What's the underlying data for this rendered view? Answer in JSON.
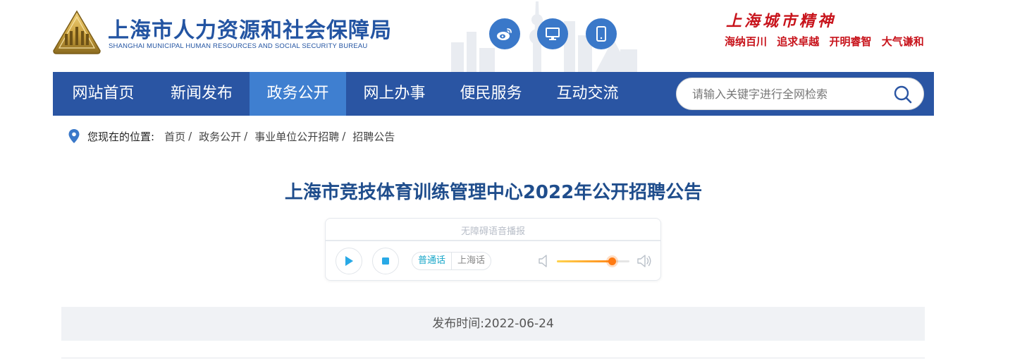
{
  "header": {
    "org_name": "上海市人力资源和社会保障局",
    "org_name_en": "SHANGHAI MUNICIPAL HUMAN RESOURCES AND SOCIAL SECURITY BUREAU",
    "share_icons": [
      "weibo-icon",
      "monitor-icon",
      "mobile-icon"
    ],
    "spirit_title": "上海城市精神",
    "spirit_phrases": [
      "海纳百川",
      "追求卓越",
      "开明睿智",
      "大气谦和"
    ]
  },
  "nav": {
    "items": [
      {
        "label": "网站首页"
      },
      {
        "label": "新闻发布"
      },
      {
        "label": "政务公开"
      },
      {
        "label": "网上办事"
      },
      {
        "label": "便民服务"
      },
      {
        "label": "互动交流"
      }
    ],
    "active": "政务公开",
    "search_placeholder": "请输入关键字进行全网检索"
  },
  "breadcrumb": {
    "lead": "您现在的位置:",
    "items": [
      "首页",
      "政务公开",
      "事业单位公开招聘",
      "招聘公告"
    ]
  },
  "article": {
    "title": "上海市竞技体育训练管理中心2022年公开招聘公告",
    "publish_label": "发布时间:2022-06-24"
  },
  "player": {
    "label": "无障碍语音播报",
    "lang_options": [
      "普通话",
      "上海话"
    ],
    "selected_lang": "普通话",
    "volume_fraction": 0.76
  },
  "colors": {
    "brand_blue": "#2a55a3",
    "nav_active": "#3f7fd0",
    "title_blue": "#1f4d8c",
    "spirit_red": "#c8141c"
  }
}
